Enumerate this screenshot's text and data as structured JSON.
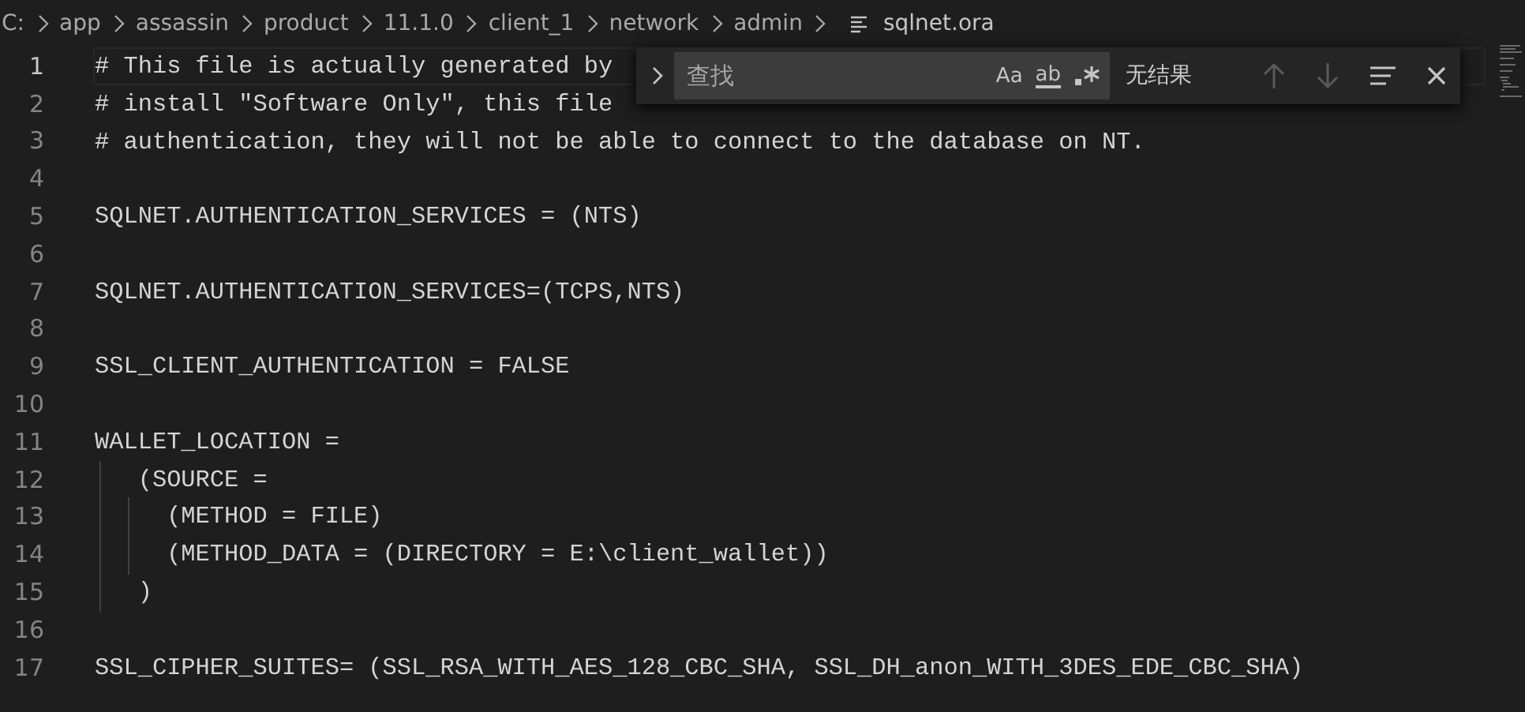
{
  "breadcrumb": {
    "items": [
      "C:",
      "app",
      "assassin",
      "product",
      "11.1.0",
      "client_1",
      "network",
      "admin"
    ],
    "file": "sqlnet.ora"
  },
  "lines": [
    {
      "number": "1",
      "text": "# This file is actually generated by",
      "active": true
    },
    {
      "number": "2",
      "text": "# install \"Software Only\", this file",
      "active": false
    },
    {
      "number": "3",
      "text": "# authentication, they will not be able to connect to the database on NT.",
      "active": false
    },
    {
      "number": "4",
      "active": false
    },
    {
      "number": "5",
      "text": "SQLNET.AUTHENTICATION_SERVICES = (NTS)",
      "active": false
    },
    {
      "number": "6",
      "active": false
    },
    {
      "number": "7",
      "text": "SQLNET.AUTHENTICATION_SERVICES=(TCPS,NTS)",
      "active": false
    },
    {
      "number": "8",
      "active": false
    },
    {
      "number": "9",
      "text": "SSL_CLIENT_AUTHENTICATION = FALSE",
      "active": false
    },
    {
      "number": "10",
      "active": false
    },
    {
      "number": "11",
      "text": "WALLET_LOCATION =",
      "active": false
    },
    {
      "number": "12",
      "text": "   (SOURCE =",
      "active": false
    },
    {
      "number": "13",
      "text": "     (METHOD = FILE)",
      "active": false
    },
    {
      "number": "14",
      "text": "     (METHOD_DATA = (DIRECTORY = E:\\client_wallet))",
      "active": false
    },
    {
      "number": "15",
      "text": "   )",
      "active": false
    },
    {
      "number": "16",
      "active": false
    },
    {
      "number": "17",
      "text": "SSL_CIPHER_SUITES= (SSL_RSA_WITH_AES_128_CBC_SHA, SSL_DH_anon_WITH_3DES_EDE_CBC_SHA)",
      "active": false
    }
  ],
  "find_widget": {
    "placeholder": "查找",
    "options": [
      "Aa",
      "ab"
    ],
    "result": "无结果",
    "previous_disabled": true,
    "next_disabled": true
  }
}
